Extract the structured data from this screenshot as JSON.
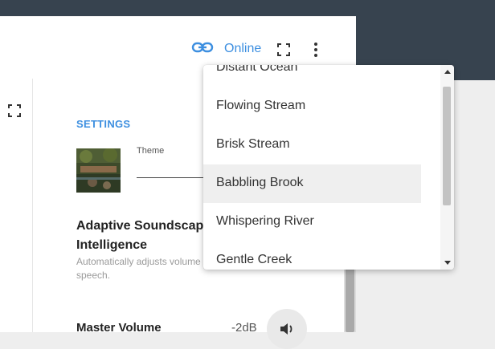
{
  "header": {
    "status_text": "Online",
    "accent_color": "#3d8fe0",
    "icons": [
      "link-icon",
      "fullscreen-icon",
      "more-vert-icon"
    ]
  },
  "settings": {
    "section_title": "SETTINGS",
    "theme_label": "Theme",
    "adaptive_title_line1": "Adaptive Soundscap",
    "adaptive_title_line2": "Intelligence",
    "adaptive_desc_line1": "Automatically adjusts volume",
    "adaptive_desc_line2": "speech.",
    "master_volume_label": "Master Volume",
    "master_volume_value": "-2dB"
  },
  "dropdown": {
    "options": [
      "Distant Ocean",
      "Flowing Stream",
      "Brisk Stream",
      "Babbling Brook",
      "Whispering River",
      "Gentle Creek"
    ],
    "highlighted": "Babbling Brook"
  }
}
